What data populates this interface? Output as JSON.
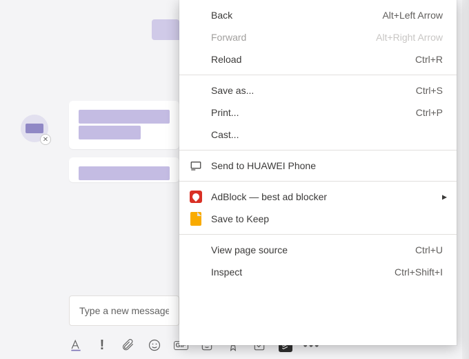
{
  "chat": {
    "compose_placeholder": "Type a new message"
  },
  "toolbar": {
    "gif_label": "GIF"
  },
  "context_menu": {
    "back": {
      "label": "Back",
      "accel": "Alt+Left Arrow",
      "enabled": true
    },
    "forward": {
      "label": "Forward",
      "accel": "Alt+Right Arrow",
      "enabled": false
    },
    "reload": {
      "label": "Reload",
      "accel": "Ctrl+R",
      "enabled": true
    },
    "save_as": {
      "label": "Save as...",
      "accel": "Ctrl+S",
      "enabled": true
    },
    "print": {
      "label": "Print...",
      "accel": "Ctrl+P",
      "enabled": true
    },
    "cast": {
      "label": "Cast...",
      "accel": "",
      "enabled": true
    },
    "send_huawei": {
      "label": "Send to HUAWEI Phone",
      "accel": "",
      "enabled": true
    },
    "adblock": {
      "label": "AdBlock — best ad blocker",
      "accel": "",
      "enabled": true,
      "submenu": true
    },
    "keep": {
      "label": "Save to Keep",
      "accel": "",
      "enabled": true
    },
    "view_source": {
      "label": "View page source",
      "accel": "Ctrl+U",
      "enabled": true
    },
    "inspect": {
      "label": "Inspect",
      "accel": "Ctrl+Shift+I",
      "enabled": true
    }
  },
  "colors": {
    "accent_lilac": "#c4bce3",
    "avatar_bg": "#e2e0ef",
    "arrow_red": "#e11b1b"
  }
}
